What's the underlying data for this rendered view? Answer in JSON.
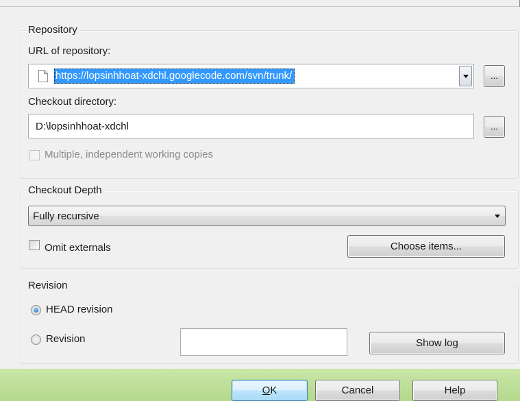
{
  "repository": {
    "legend": "Repository",
    "url_label": "URL of repository:",
    "url_value": "https://lopsinhhoat-xdchl.googlecode.com/svn/trunk/",
    "url_browse_label": "...",
    "checkout_dir_label": "Checkout directory:",
    "checkout_dir_value": "D:\\lopsinhhoat-xdchl",
    "dir_browse_label": "...",
    "multiple_copies_label": "Multiple, independent working copies",
    "multiple_copies_checked": false
  },
  "checkout_depth": {
    "legend": "Checkout Depth",
    "selected": "Fully recursive",
    "omit_externals_label": "Omit externals",
    "omit_externals_checked": false,
    "choose_items_label": "Choose items..."
  },
  "revision": {
    "legend": "Revision",
    "head_label": "HEAD revision",
    "head_selected": true,
    "revision_label": "Revision",
    "revision_value": "",
    "show_log_label": "Show log"
  },
  "buttons": {
    "ok_accel": "O",
    "ok_rest": "K",
    "cancel": "Cancel",
    "help": "Help"
  },
  "colors": {
    "selection": "#3399ff",
    "footer": "#b4d88c",
    "radio_dot": "#1a5fa8"
  }
}
